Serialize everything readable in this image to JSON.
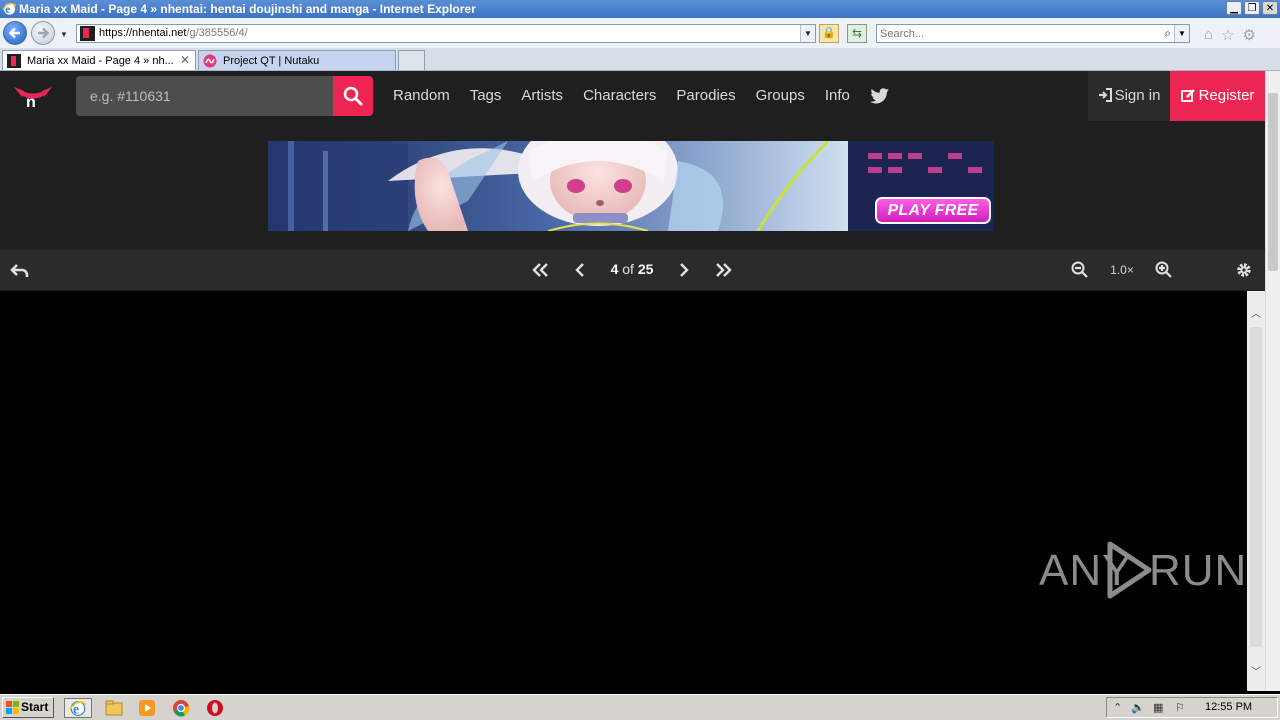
{
  "window": {
    "title": "Maria xx Maid - Page 4 » nhentai: hentai doujinshi and manga - Internet Explorer"
  },
  "browser": {
    "url_host": "https://nhentai.net",
    "url_path": "/g/385556/4/",
    "search_placeholder": "Search...",
    "tabs": [
      {
        "label": "Maria xx Maid - Page 4 » nh...",
        "active": true
      },
      {
        "label": "Project QT | Nutaku",
        "active": false
      }
    ]
  },
  "site": {
    "search_placeholder": "e.g. #110631",
    "menu": [
      "Random",
      "Tags",
      "Artists",
      "Characters",
      "Parodies",
      "Groups",
      "Info"
    ],
    "signin_label": "Sign in",
    "register_label": "Register",
    "ad_button": "PLAY FREE",
    "accent": "#ed2553"
  },
  "reader": {
    "current_page": "4",
    "page_sep": "of",
    "total_pages": "25",
    "zoom": "1.0×"
  },
  "watermark": {
    "left": "ANY",
    "right": "RUN"
  },
  "taskbar": {
    "start_label": "Start",
    "clock": "12:55 PM"
  }
}
